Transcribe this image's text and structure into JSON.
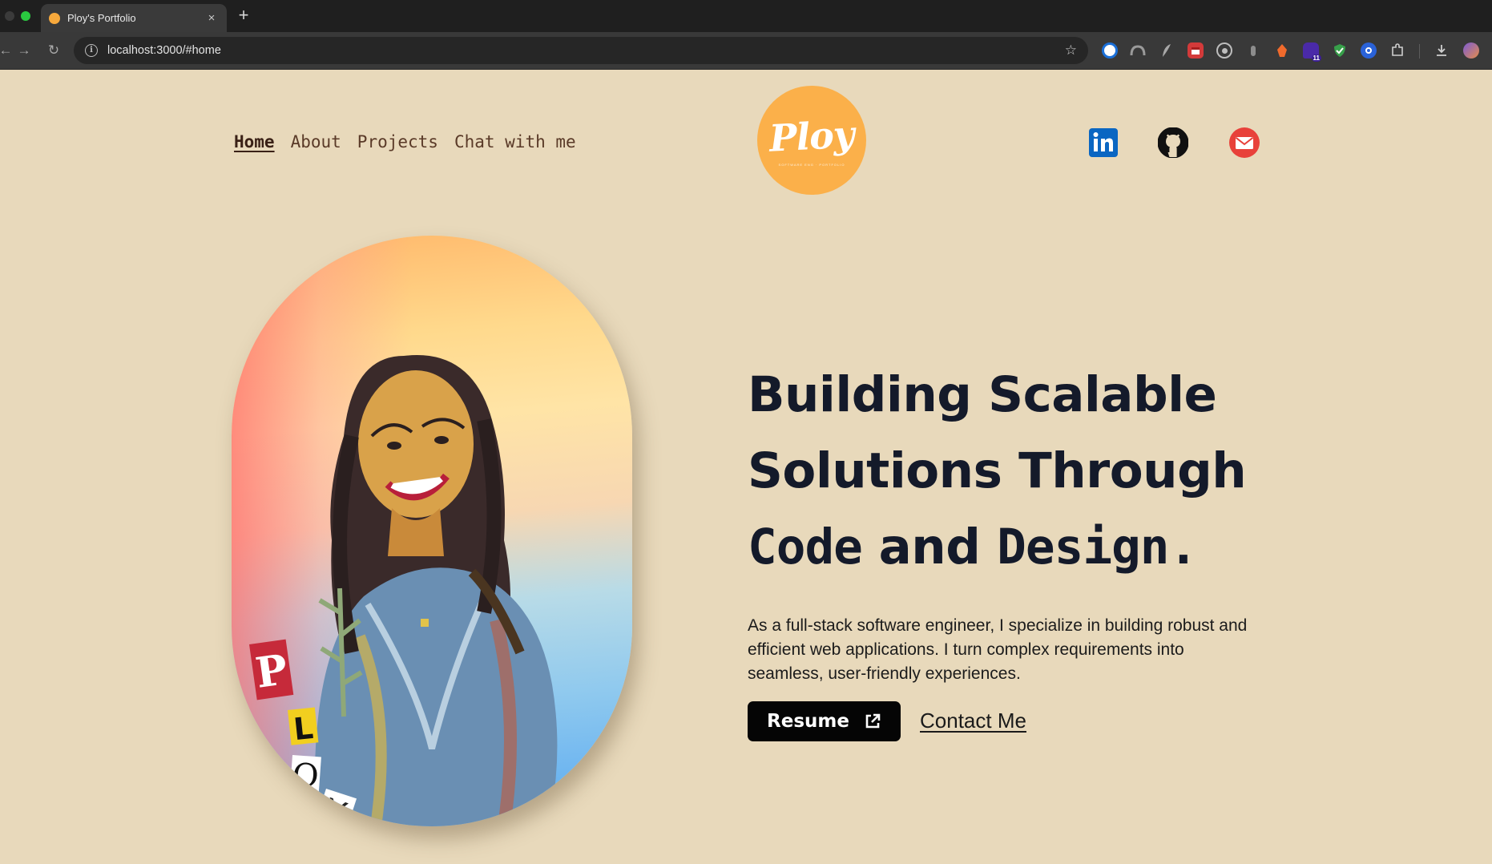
{
  "browser": {
    "tab_title": "Ploy's Portfolio",
    "tab_close": "×",
    "new_tab": "+",
    "url": "localhost:3000/#home",
    "back": "←",
    "forward": "→",
    "reload": "↻",
    "bookmark": "☆",
    "info": "i",
    "extensions": [
      "onepassword-icon",
      "cloud-icon",
      "feather-icon",
      "calendar-icon",
      "target-icon",
      "bottle-icon",
      "fox-icon",
      "badge-icon",
      "shield-check-icon",
      "sync-icon",
      "puzzle-icon",
      "download-icon",
      "profile-icon"
    ],
    "extension_badge": "11"
  },
  "nav": {
    "items": [
      {
        "label": "Home",
        "active": true
      },
      {
        "label": "About",
        "active": false
      },
      {
        "label": "Projects",
        "active": false
      },
      {
        "label": "Chat with me",
        "active": false
      }
    ]
  },
  "logo": {
    "text": "Ploy",
    "tagline": "SOFTWARE ENG · PORTFOLIO"
  },
  "social": [
    "linkedin-icon",
    "github-icon",
    "email-icon"
  ],
  "hero": {
    "headline_line1": "Building Scalable",
    "headline_line2": "Solutions Through",
    "headline_line3a": "Code",
    "headline_line3b": " and ",
    "headline_line3c": "Design.",
    "intro": "As a full-stack software engineer, I specialize in building robust and efficient web applications. I turn complex requirements into seamless, user-friendly experiences.",
    "resume_label": "Resume",
    "contact_label": "Contact Me",
    "portrait_letters": [
      "P",
      "L",
      "O",
      "Y"
    ]
  },
  "colors": {
    "page_bg": "#e8d9bb",
    "nav_text": "#5a3a28",
    "headline": "#141a2a",
    "logo_orange": "#fbb04a",
    "linkedin": "#0a66c2",
    "email_red": "#e8413a"
  }
}
